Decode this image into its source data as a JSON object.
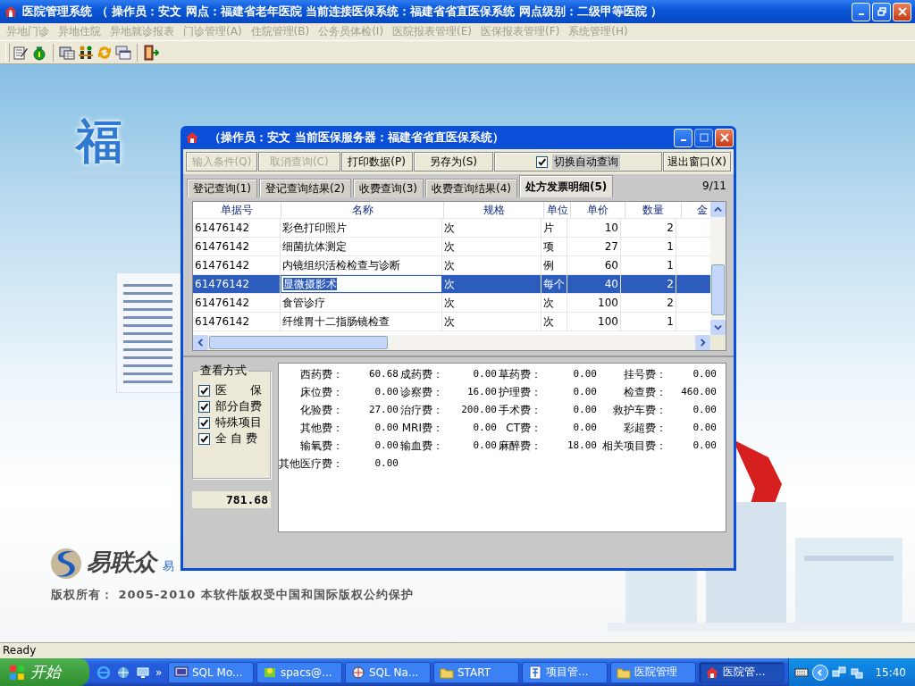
{
  "window": {
    "title": "医院管理系统 （ 操作员：安文  网点：福建省老年医院    当前连接医保系统：福建省省直医保系统  网点级别：二级甲等医院 ）"
  },
  "menu": [
    {
      "label": "异地门诊",
      "disabled": true
    },
    {
      "label": "异地住院",
      "disabled": true
    },
    {
      "label": "异地就诊报表",
      "disabled": true
    },
    {
      "label": "门诊管理(A)",
      "disabled": true
    },
    {
      "label": "住院管理(B)",
      "disabled": true
    },
    {
      "label": "公务员体检(I)",
      "disabled": true
    },
    {
      "label": "医院报表管理(E)",
      "disabled": true
    },
    {
      "label": "医保报表管理(F)",
      "disabled": true
    },
    {
      "label": "系统管理(H)",
      "disabled": true
    }
  ],
  "splash": {
    "heading": [
      "福"
    ],
    "brand": "易联众",
    "brand_caption": "易",
    "copyright": "版权所有： 2005-2010  本软件版权受中国和国际版权公约保护"
  },
  "dialog": {
    "title": "（操作员：安文 当前医保服务器：福建省省直医保系统）",
    "buttons": [
      {
        "label": "输入条件(Q)",
        "disabled": true
      },
      {
        "label": "取消查询(C)",
        "disabled": true
      },
      {
        "label": "打印数据(P)",
        "disabled": false
      },
      {
        "label": "另存为(S)",
        "disabled": false
      }
    ],
    "auto_query": {
      "label": "切换自动查询",
      "checked": true
    },
    "exit_button": "退出窗口(X)",
    "tabs": [
      {
        "label": "登记查询(1)",
        "selected": false
      },
      {
        "label": "登记查询结果(2)",
        "selected": false
      },
      {
        "label": "收费查询(3)",
        "selected": false
      },
      {
        "label": "收费查询结果(4)",
        "selected": false
      },
      {
        "label": "处方发票明细(5)",
        "selected": true
      }
    ],
    "page_counter": "9/11",
    "table": {
      "columns": [
        "单据号",
        "名称",
        "规格",
        "单位",
        "单价",
        "数量",
        "金"
      ],
      "rows": [
        {
          "cells": [
            "61476142",
            "彩色打印照片",
            "次",
            "片",
            "10",
            "2"
          ],
          "selected": false,
          "editing": false
        },
        {
          "cells": [
            "61476142",
            "细菌抗体测定",
            "次",
            "项",
            "27",
            "1"
          ],
          "selected": false,
          "editing": false
        },
        {
          "cells": [
            "61476142",
            "内镜组织活检检查与诊断",
            "次",
            "例",
            "60",
            "1"
          ],
          "selected": false,
          "editing": false
        },
        {
          "cells": [
            "61476142",
            "显微摄影术",
            "次",
            "每个",
            "40",
            "2"
          ],
          "selected": true,
          "editing": true
        },
        {
          "cells": [
            "61476142",
            "食管诊疗",
            "次",
            "次",
            "100",
            "2"
          ],
          "selected": false,
          "editing": false
        },
        {
          "cells": [
            "61476142",
            "纤维胃十二指肠镜检查",
            "次",
            "次",
            "100",
            "1"
          ],
          "selected": false,
          "editing": false
        }
      ]
    },
    "view_mode": {
      "title": "查看方式",
      "options": [
        {
          "label": "医　　保",
          "checked": true
        },
        {
          "label": "部分自费",
          "checked": true
        },
        {
          "label": "特殊项目",
          "checked": true
        },
        {
          "label": "全 自 费",
          "checked": true
        }
      ]
    },
    "total": "781.68",
    "fees": [
      {
        "label": "西药费：",
        "value": "60.68"
      },
      {
        "label": "成药费：",
        "value": "0.00"
      },
      {
        "label": "草药费：",
        "value": "0.00"
      },
      {
        "label": "挂号费：",
        "value": "0.00"
      },
      {
        "label": "床位费：",
        "value": "0.00"
      },
      {
        "label": "诊察费：",
        "value": "16.00"
      },
      {
        "label": "护理费：",
        "value": "0.00"
      },
      {
        "label": "检查费：",
        "value": "460.00"
      },
      {
        "label": "化验费：",
        "value": "27.00"
      },
      {
        "label": "治疗费：",
        "value": "200.00"
      },
      {
        "label": "手术费：",
        "value": "0.00"
      },
      {
        "label": "救护车费：",
        "value": "0.00"
      },
      {
        "label": "其他费：",
        "value": "0.00"
      },
      {
        "label": "MRI费：",
        "value": "0.00"
      },
      {
        "label": "CT费：",
        "value": "0.00"
      },
      {
        "label": "彩超费：",
        "value": "0.00"
      },
      {
        "label": "输氧费：",
        "value": "0.00"
      },
      {
        "label": "输血费：",
        "value": "0.00"
      },
      {
        "label": "麻醉费：",
        "value": "18.00"
      },
      {
        "label": "相关项目费：",
        "value": "0.00"
      },
      {
        "label": "其他医疗费：",
        "value": "0.00"
      }
    ]
  },
  "status_bar": "Ready",
  "taskbar": {
    "start": "开始",
    "overflow": "»",
    "tasks": [
      {
        "label": "SQL Mo...",
        "kind": "monitor",
        "active": false
      },
      {
        "label": "spacs@...",
        "kind": "app",
        "active": false
      },
      {
        "label": "SQL Na...",
        "kind": "globe",
        "active": false
      },
      {
        "label": "START",
        "kind": "folder",
        "active": false
      },
      {
        "label": "项目管...",
        "kind": "form",
        "active": false
      },
      {
        "label": "医院管理",
        "kind": "folder",
        "active": false
      },
      {
        "label": "医院管...",
        "kind": "house",
        "active": true
      }
    ],
    "clock": "15:40"
  }
}
